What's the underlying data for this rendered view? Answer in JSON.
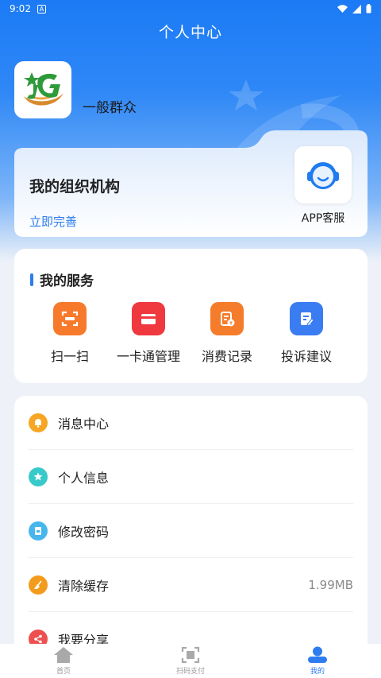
{
  "status_bar": {
    "time": "9:02",
    "notif_label": "A"
  },
  "page": {
    "title": "个人中心"
  },
  "user": {
    "name": "一般群众"
  },
  "org_card": {
    "title": "我的组织机构",
    "action_link": "立即完善",
    "support_label": "APP客服"
  },
  "services": {
    "heading": "我的服务",
    "items": [
      {
        "label": "扫一扫",
        "icon": "scan-icon",
        "color": "#f77a2c"
      },
      {
        "label": "一卡通管理",
        "icon": "card-icon",
        "color": "#f0383f"
      },
      {
        "label": "消费记录",
        "icon": "receipt-icon",
        "color": "#f47c2b"
      },
      {
        "label": "投诉建议",
        "icon": "edit-note-icon",
        "color": "#3a7cf2"
      }
    ]
  },
  "menu": {
    "items": [
      {
        "label": "消息中心",
        "icon": "bell-icon",
        "color": "#f6a623",
        "value": ""
      },
      {
        "label": "个人信息",
        "icon": "star-icon",
        "color": "#38c9c9",
        "value": ""
      },
      {
        "label": "修改密码",
        "icon": "lock-doc-icon",
        "color": "#46b6ec",
        "value": ""
      },
      {
        "label": "清除缓存",
        "icon": "broom-icon",
        "color": "#f39b1c",
        "value": "1.99MB"
      },
      {
        "label": "我要分享",
        "icon": "share-icon",
        "color": "#ee4f4f",
        "value": ""
      }
    ]
  },
  "tabbar": {
    "tabs": [
      {
        "label": "首页",
        "icon": "home-icon",
        "active": false
      },
      {
        "label": "扫码支付",
        "icon": "scan-pay-icon",
        "active": false
      },
      {
        "label": "我的",
        "icon": "user-icon",
        "active": true
      }
    ]
  },
  "colors": {
    "primary": "#2d7cf0",
    "hero": "#1b7af5"
  }
}
